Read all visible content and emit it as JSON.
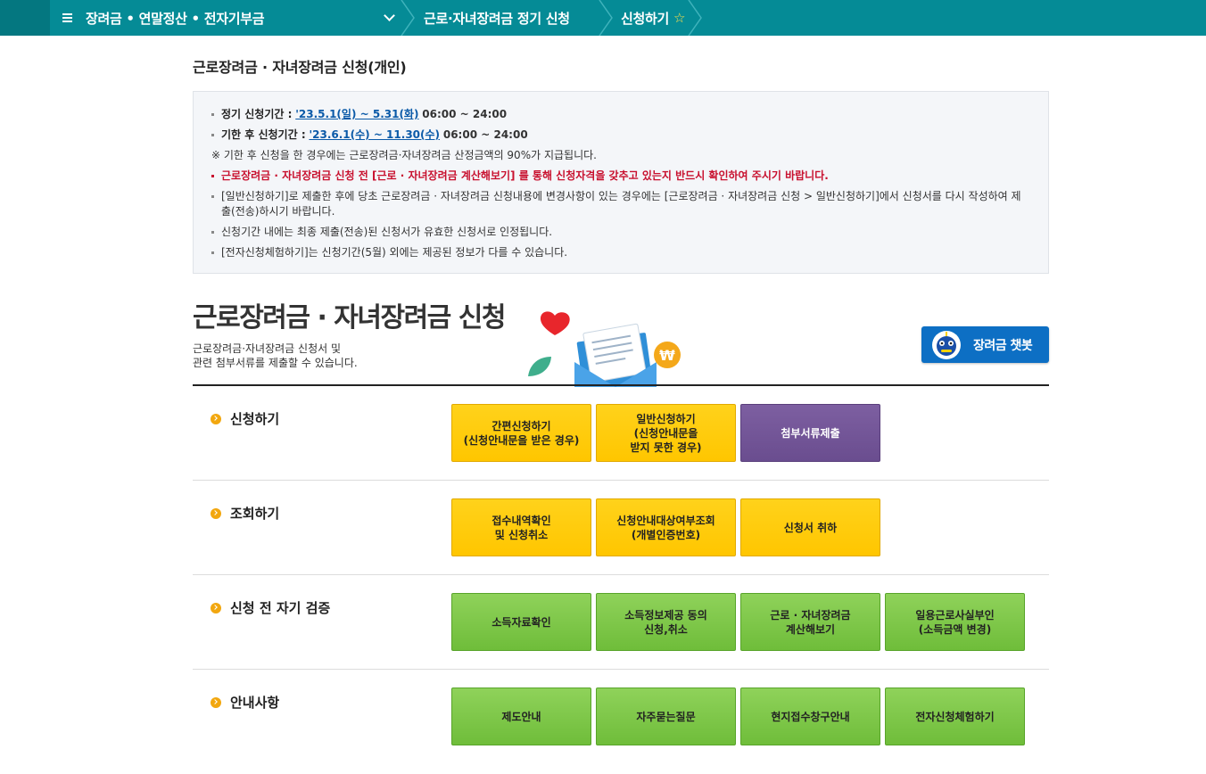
{
  "topbar": {
    "main_menu": "장려금 • 연말정산 • 전자기부금",
    "breadcrumb_1": "근로·자녀장려금 정기 신청",
    "breadcrumb_2": "신청하기",
    "star_icon": "star-outline-icon"
  },
  "page_title": "근로장려금 · 자녀장려금 신청(개인)",
  "notice": {
    "period1_label": "정기 신청기간 :",
    "period1_dates": "'23.5.1(일) ~ 5.31(화)",
    "period1_time": "06:00 ~ 24:00",
    "period2_label": "기한 후 신청기간 :",
    "period2_dates": "'23.6.1(수) ~ 11.30(수)",
    "period2_time": "06:00 ~ 24:00",
    "note": "※ 기한 후 신청을 한 경우에는 근로장려금·자녀장려금 산정금액의 90%가 지급됩니다.",
    "warning": "근로장려금 · 자녀장려금 신청 전 [근로 · 자녀장려금 계산해보기] 를 통해 신청자격을 갖추고 있는지 반드시 확인하여 주시기 바랍니다.",
    "item1": "[일반신청하기]로 제출한 후에 당초 근로장려금 · 자녀장려금 신청내용에 변경사항이 있는 경우에는  [근로장려금 · 자녀장려금 신청 > 일반신청하기]에서  신청서를 다시 작성하여 제출(전송)하시기 바랍니다.",
    "item2": "신청기간 내에는 최종 제출(전송)된 신청서가 유효한 신청서로 인정됩니다.",
    "item3": "[전자신청체험하기]는 신청기간(5월) 외에는 제공된 정보가 다를 수 있습니다."
  },
  "hero": {
    "title": "근로장려금 · 자녀장려금 신청",
    "desc_line1": "근로장려금·자녀장려금 신청서 및",
    "desc_line2": "관련 첨부서류를 제출할 수 있습니다.",
    "chatbot_label": "장려금 챗봇"
  },
  "sections": {
    "apply": {
      "label": "신청하기",
      "btn1": "간편신청하기\n(신청안내문을 받은 경우)",
      "btn2": "일반신청하기\n(신청안내문을\n받지 못한 경우)",
      "btn3": "첨부서류제출"
    },
    "inquiry": {
      "label": "조회하기",
      "btn1": "접수내역확인\n및 신청취소",
      "btn2": "신청안내대상여부조회\n(개별인증번호)",
      "btn3": "신청서 취하"
    },
    "verify": {
      "label": "신청 전 자기 검증",
      "btn1": "소득자료확인",
      "btn2": "소득정보제공 동의\n신청,취소",
      "btn3": "근로 · 자녀장려금\n계산해보기",
      "btn4": "일용근로사실부인\n(소득금액 변경)"
    },
    "guide": {
      "label": "안내사항",
      "btn1": "제도안내",
      "btn2": "자주묻는질문",
      "btn3": "현지접수창구안내",
      "btn4": "전자신청체험하기"
    }
  },
  "colors": {
    "topbar": "#058b96",
    "yellow_button": "#ffcc0d",
    "purple_button": "#745696",
    "green_button": "#7fc74a",
    "chatbot": "#0d6fc4",
    "warning_red": "#c8102e",
    "link_blue": "#0b5aa8"
  }
}
